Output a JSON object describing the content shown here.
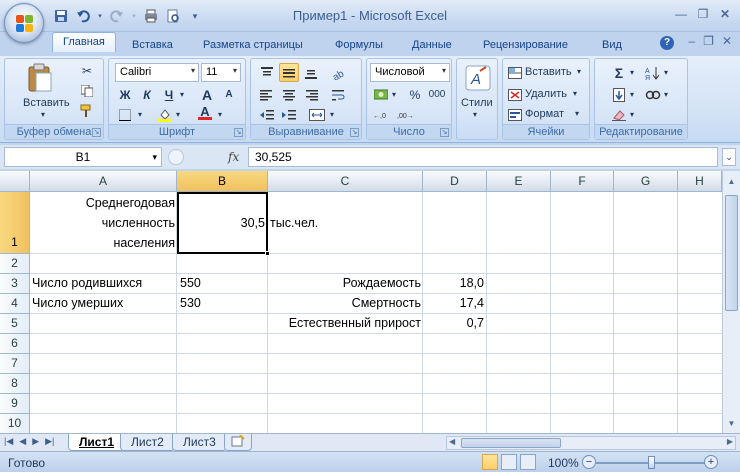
{
  "window": {
    "title": "Пример1 - Microsoft Excel"
  },
  "ribbon_tabs": [
    "Главная",
    "Вставка",
    "Разметка страницы",
    "Формулы",
    "Данные",
    "Рецензирование",
    "Вид"
  ],
  "ribbon": {
    "clipboard": {
      "label": "Буфер обмена",
      "paste": "Вставить"
    },
    "font": {
      "label": "Шрифт",
      "name": "Calibri",
      "size": "11",
      "bold": "Ж",
      "italic": "К",
      "underline": "Ч",
      "grow": "A",
      "shrink": "A",
      "font_color": "A"
    },
    "alignment": {
      "label": "Выравнивание"
    },
    "number": {
      "label": "Число",
      "format": "Числовой",
      "percent": "%",
      "thousands": "000"
    },
    "styles": {
      "label": "Стили"
    },
    "cells": {
      "label": "Ячейки",
      "insert": "Вставить",
      "delete": "Удалить",
      "format": "Формат"
    },
    "editing": {
      "label": "Редактирование",
      "sum": "Σ"
    }
  },
  "formula_bar": {
    "name_box": "B1",
    "fx": "fx",
    "value": "30,525"
  },
  "columns": [
    "A",
    "B",
    "C",
    "D",
    "E",
    "F",
    "G",
    "H"
  ],
  "rows": [
    "1",
    "2",
    "3",
    "4",
    "5",
    "6",
    "7",
    "8",
    "9",
    "10"
  ],
  "cells": {
    "A1": [
      "Среднегодовая",
      "численность",
      "населения"
    ],
    "B1": "30,5",
    "C1": "тыс.чел.",
    "A3": "Число родившихся",
    "B3": "550",
    "C3": "Рождаемость",
    "D3": "18,0",
    "A4": "Число умерших",
    "B4": "530",
    "C4": "Смертность",
    "D4": "17,4",
    "C5": "Естественный прирост",
    "D5": "0,7"
  },
  "sheets": [
    "Лист1",
    "Лист2",
    "Лист3"
  ],
  "active_sheet": "Лист1",
  "status": {
    "text": "Готово",
    "zoom": "100%"
  },
  "colors": {
    "accent": "#15428b",
    "selected_header": "#f1c15f"
  }
}
